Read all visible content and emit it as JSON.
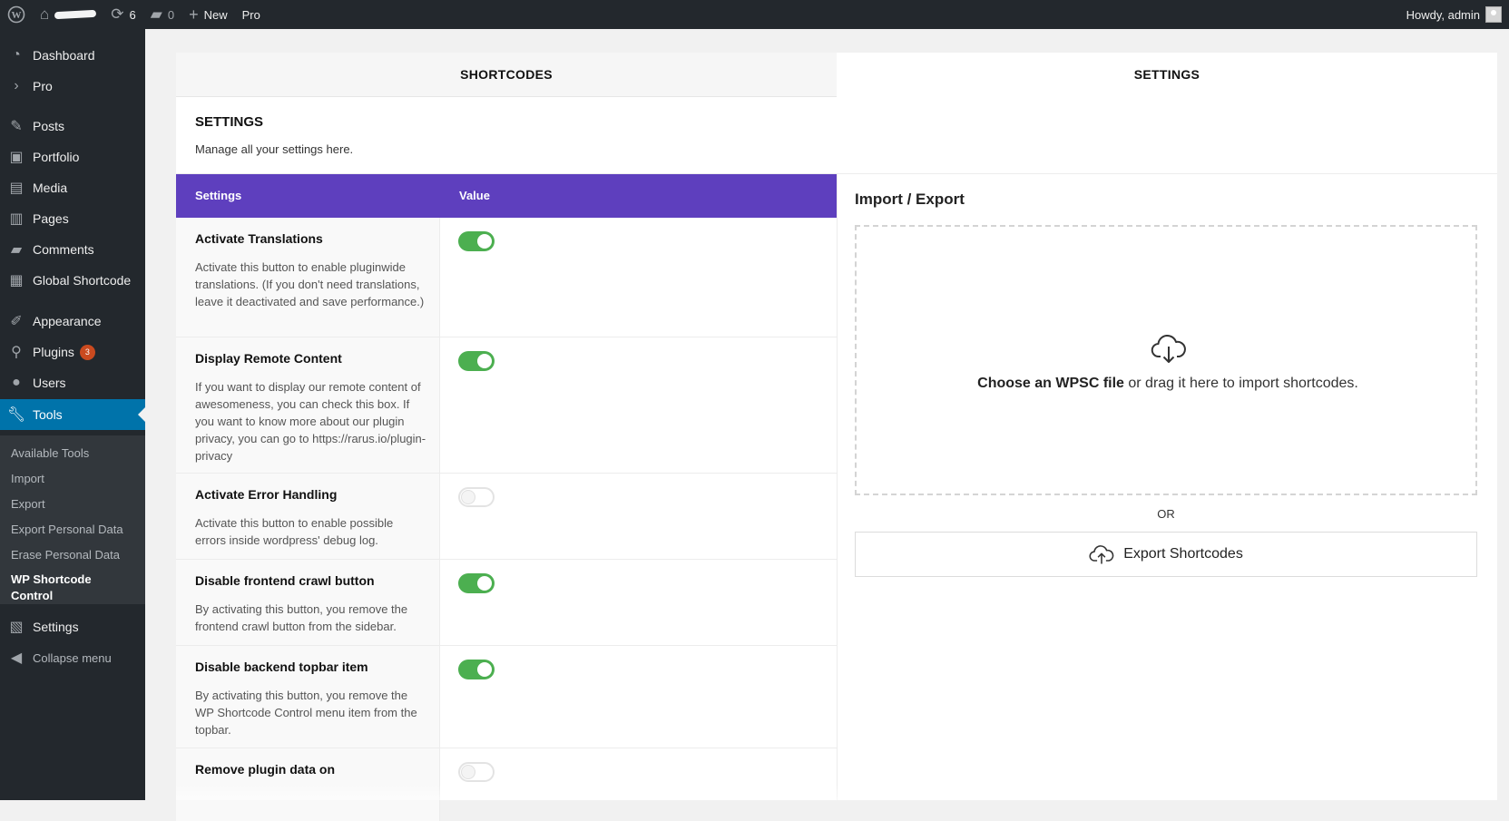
{
  "adminbar": {
    "updates_count": "6",
    "comments_count": "0",
    "new_label": "New",
    "pro_label": "Pro",
    "greeting": "Howdy, admin"
  },
  "sidebar": {
    "items": [
      {
        "label": "Dashboard",
        "icon": "dashboard-icon"
      },
      {
        "label": "Pro",
        "icon": "chevron-right-icon"
      },
      {
        "label": "Posts",
        "icon": "pin-icon"
      },
      {
        "label": "Portfolio",
        "icon": "portfolio-icon"
      },
      {
        "label": "Media",
        "icon": "media-icon"
      },
      {
        "label": "Pages",
        "icon": "pages-icon"
      },
      {
        "label": "Comments",
        "icon": "comment-icon"
      },
      {
        "label": "Global Shortcode",
        "icon": "grid-icon"
      },
      {
        "label": "Appearance",
        "icon": "brush-icon"
      },
      {
        "label": "Plugins",
        "icon": "plugin-icon",
        "badge": "3"
      },
      {
        "label": "Users",
        "icon": "user-icon"
      },
      {
        "label": "Tools",
        "icon": "wrench-icon"
      },
      {
        "label": "Settings",
        "icon": "settings-icon"
      },
      {
        "label": "Collapse menu",
        "icon": "collapse-icon"
      }
    ],
    "submenu": [
      "Available Tools",
      "Import",
      "Export",
      "Export Personal Data",
      "Erase Personal Data",
      "WP Shortcode Control"
    ],
    "current_color": "#0073aa"
  },
  "tabs": {
    "shortcodes": "SHORTCODES",
    "settings": "SETTINGS"
  },
  "section": {
    "title": "SETTINGS",
    "description": "Manage all your settings here."
  },
  "table": {
    "header_color": "#5e3fbe",
    "col_settings": "Settings",
    "col_value": "Value",
    "rows": [
      {
        "title": "Activate Translations",
        "description": "Activate this button to enable pluginwide translations. (If you don't need translations, leave it deactivated and save performance.)",
        "enabled": true
      },
      {
        "title": "Display Remote Content",
        "description": "If you want to display our remote content of awesomeness, you can check this box. If you want to know more about our plugin privacy, you can go to https://rarus.io/plugin-privacy",
        "enabled": true
      },
      {
        "title": "Activate Error Handling",
        "description": "Activate this button to enable possible errors inside wordpress' debug log.",
        "enabled": false
      },
      {
        "title": "Disable frontend crawl button",
        "description": "By activating this button, you remove the frontend crawl button from the sidebar.",
        "enabled": true
      },
      {
        "title": "Disable backend topbar item",
        "description": "By activating this button, you remove the WP Shortcode Control menu item from the topbar.",
        "enabled": true
      },
      {
        "title": "Remove plugin data on",
        "description": "",
        "enabled": false
      }
    ]
  },
  "import_export": {
    "title": "Import / Export",
    "dropzone_bold": "Choose an WPSC file",
    "dropzone_rest": " or drag it here to import shortcodes.",
    "or_label": "OR",
    "export_label": "Export Shortcodes"
  },
  "colors": {
    "toggle_on": "#4caf50",
    "adminbar": "#23282d"
  }
}
